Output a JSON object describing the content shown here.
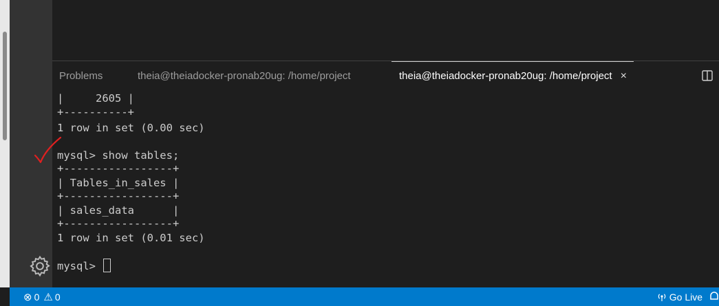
{
  "panel": {
    "tabs": [
      {
        "label": "Problems"
      },
      {
        "label": "theia@theiadocker-pronab20ug: /home/project"
      },
      {
        "label": "theia@theiadocker-pronab20ug: /home/project"
      }
    ],
    "close_glyph": "×"
  },
  "terminal": {
    "lines": [
      "|     2605 |",
      "+----------+",
      "1 row in set (0.00 sec)",
      "",
      "mysql> show tables;",
      "+-----------------+",
      "| Tables_in_sales |",
      "+-----------------+",
      "| sales_data      |",
      "+-----------------+",
      "1 row in set (0.01 sec)",
      "",
      "mysql> "
    ]
  },
  "status_bar": {
    "error_glyph": "⊗",
    "errors": "0",
    "warning_glyph": "⚠",
    "warnings": "0",
    "go_live": "Go Live"
  },
  "colors": {
    "status_bar": "#007acc",
    "activity_bar": "#333333",
    "terminal_bg": "#1e1e1e",
    "annotation_mark": "#e02020"
  }
}
